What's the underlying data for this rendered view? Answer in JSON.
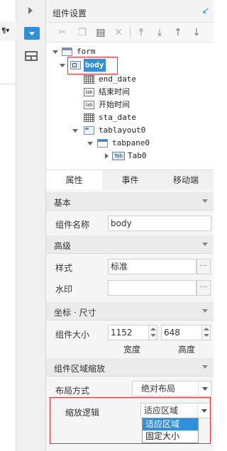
{
  "panel": {
    "title": "组件设置"
  },
  "toolbar": [
    {
      "name": "cut-icon",
      "glyph": "✂"
    },
    {
      "name": "copy-icon",
      "glyph": "❐"
    },
    {
      "name": "paste-icon",
      "glyph": "▤"
    },
    {
      "name": "delete-icon",
      "glyph": "✕"
    },
    {
      "name": "move-top-icon",
      "glyph": "⤒"
    },
    {
      "name": "move-bottom-icon",
      "glyph": "⤓"
    },
    {
      "name": "move-up-icon",
      "glyph": "↑"
    },
    {
      "name": "move-down-icon",
      "glyph": "↓"
    }
  ],
  "tree": {
    "form": "form",
    "body": "body",
    "end_date": "end_date",
    "end_label": "结束时间",
    "start_label": "开始时间",
    "sta_date": "sta_date",
    "tablayout": "tablayout0",
    "tabpane": "tabpane0",
    "tab": "Tab0",
    "lab_icon_text": "lab",
    "tab_icon_text": "Tab"
  },
  "tabs": [
    "属性",
    "事件",
    "移动端"
  ],
  "props": {
    "basic_section": "基本",
    "name_label": "组件名称",
    "name_value": "body",
    "advanced_section": "高级",
    "style_label": "样式",
    "style_value": "标准",
    "watermark_label": "水印",
    "watermark_value": "",
    "more_label": "···",
    "coord_section": "坐标 · 尺寸",
    "size_label": "组件大小",
    "width_value": "1152",
    "height_value": "648",
    "width_label": "宽度",
    "height_label": "高度",
    "scale_section": "组件区域缩放",
    "layout_label": "布局方式",
    "layout_value": "绝对布局",
    "scale_label": "缩放逻辑",
    "scale_value": "适应区域",
    "scale_options": [
      "适应区域",
      "固定大小"
    ]
  }
}
